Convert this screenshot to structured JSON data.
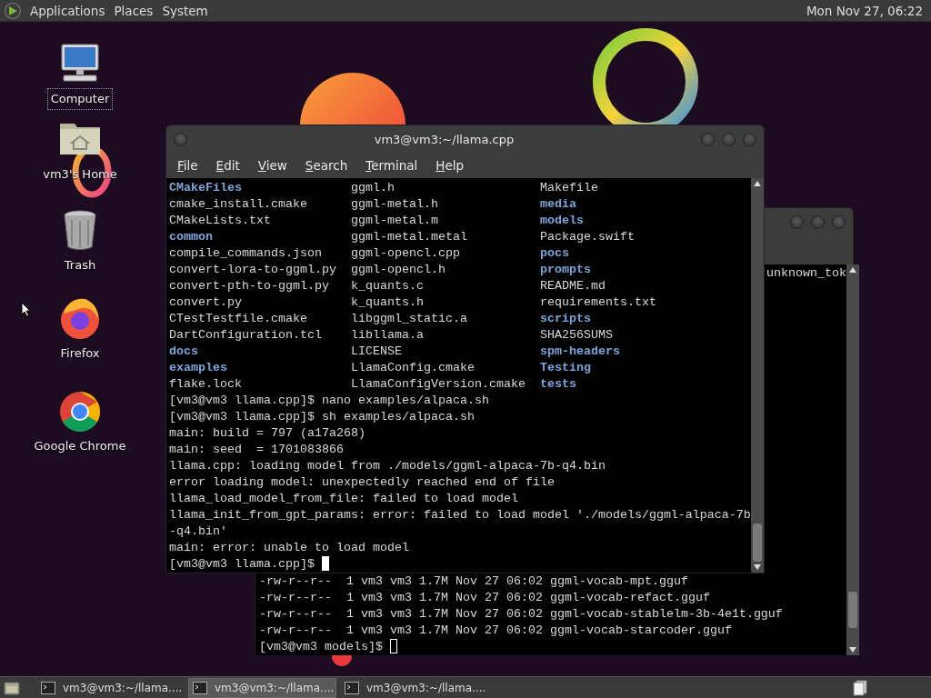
{
  "top_panel": {
    "menus": [
      "Applications",
      "Places",
      "System"
    ],
    "clock": "Mon Nov 27, 06:22"
  },
  "desktop_icons": [
    {
      "label": "Computer",
      "kind": "computer",
      "selected": true
    },
    {
      "label": "vm3's Home",
      "kind": "home",
      "selected": false
    },
    {
      "label": "Trash",
      "kind": "trash",
      "selected": false
    },
    {
      "label": "Firefox",
      "kind": "firefox",
      "selected": false
    },
    {
      "label": "Google Chrome",
      "kind": "chrome",
      "selected": false
    }
  ],
  "back_terminal": {
    "top_line": "unknown_tok",
    "lines": [
      "-rw-r--r--  1 vm3 vm3 1.7M Nov 27 06:02 ggml-vocab-mpt.gguf",
      "-rw-r--r--  1 vm3 vm3 1.7M Nov 27 06:02 ggml-vocab-refact.gguf",
      "-rw-r--r--  1 vm3 vm3 1.7M Nov 27 06:02 ggml-vocab-stablelm-3b-4e1t.gguf",
      "-rw-r--r--  1 vm3 vm3 1.7M Nov 27 06:02 ggml-vocab-starcoder.gguf"
    ],
    "prompt": "[vm3@vm3 models]$ "
  },
  "front_terminal": {
    "title": "vm3@vm3:~/llama.cpp",
    "menu": [
      "File",
      "Edit",
      "View",
      "Search",
      "Terminal",
      "Help"
    ],
    "listing": [
      [
        {
          "name": "CMakeFiles",
          "directory": true
        },
        {
          "name": "ggml.h",
          "directory": false
        },
        {
          "name": "Makefile",
          "directory": false
        }
      ],
      [
        {
          "name": "cmake_install.cmake",
          "directory": false
        },
        {
          "name": "ggml-metal.h",
          "directory": false
        },
        {
          "name": "media",
          "directory": true
        }
      ],
      [
        {
          "name": "CMakeLists.txt",
          "directory": false
        },
        {
          "name": "ggml-metal.m",
          "directory": false
        },
        {
          "name": "models",
          "directory": true
        }
      ],
      [
        {
          "name": "common",
          "directory": true
        },
        {
          "name": "ggml-metal.metal",
          "directory": false
        },
        {
          "name": "Package.swift",
          "directory": false
        }
      ],
      [
        {
          "name": "compile_commands.json",
          "directory": false
        },
        {
          "name": "ggml-opencl.cpp",
          "directory": false
        },
        {
          "name": "pocs",
          "directory": true
        }
      ],
      [
        {
          "name": "convert-lora-to-ggml.py",
          "directory": false
        },
        {
          "name": "ggml-opencl.h",
          "directory": false
        },
        {
          "name": "prompts",
          "directory": true
        }
      ],
      [
        {
          "name": "convert-pth-to-ggml.py",
          "directory": false
        },
        {
          "name": "k_quants.c",
          "directory": false
        },
        {
          "name": "README.md",
          "directory": false
        }
      ],
      [
        {
          "name": "convert.py",
          "directory": false
        },
        {
          "name": "k_quants.h",
          "directory": false
        },
        {
          "name": "requirements.txt",
          "directory": false
        }
      ],
      [
        {
          "name": "CTestTestfile.cmake",
          "directory": false
        },
        {
          "name": "libggml_static.a",
          "directory": false
        },
        {
          "name": "scripts",
          "directory": true
        }
      ],
      [
        {
          "name": "DartConfiguration.tcl",
          "directory": false
        },
        {
          "name": "libllama.a",
          "directory": false
        },
        {
          "name": "SHA256SUMS",
          "directory": false
        }
      ],
      [
        {
          "name": "docs",
          "directory": true
        },
        {
          "name": "LICENSE",
          "directory": false
        },
        {
          "name": "spm-headers",
          "directory": true
        }
      ],
      [
        {
          "name": "examples",
          "directory": true
        },
        {
          "name": "LlamaConfig.cmake",
          "directory": false
        },
        {
          "name": "Testing",
          "directory": true
        }
      ],
      [
        {
          "name": "flake.lock",
          "directory": false
        },
        {
          "name": "LlamaConfigVersion.cmake",
          "directory": false
        },
        {
          "name": "tests",
          "directory": true
        }
      ]
    ],
    "output_lines": [
      "[vm3@vm3 llama.cpp]$ nano examples/alpaca.sh",
      "[vm3@vm3 llama.cpp]$ sh examples/alpaca.sh",
      "main: build = 797 (a17a268)",
      "main: seed  = 1701083866",
      "llama.cpp: loading model from ./models/ggml-alpaca-7b-q4.bin",
      "error loading model: unexpectedly reached end of file",
      "llama_load_model_from_file: failed to load model",
      "llama_init_from_gpt_params: error: failed to load model './models/ggml-alpaca-7b",
      "-q4.bin'",
      "main: error: unable to load model"
    ],
    "prompt": "[vm3@vm3 llama.cpp]$ "
  },
  "taskbar": {
    "tasks": [
      {
        "label": "vm3@vm3:~/llama....",
        "selected": false
      },
      {
        "label": "vm3@vm3:~/llama....",
        "selected": true
      },
      {
        "label": "vm3@vm3:~/llama....",
        "selected": false
      }
    ]
  }
}
